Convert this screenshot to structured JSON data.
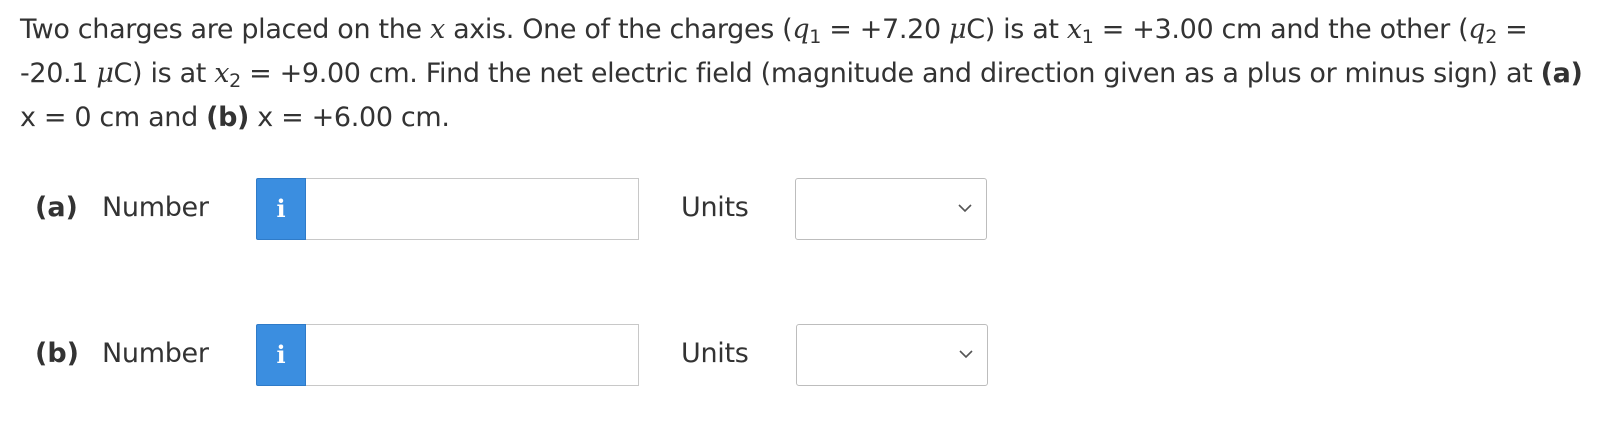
{
  "question": {
    "t1": "Two charges are placed on the ",
    "x_var": "x",
    "t2": " axis. One of the charges (",
    "q": "q",
    "sub1": "1",
    "t3": " = +7.20 ",
    "mu": "μ",
    "t4": "C) is at ",
    "x1": "x",
    "sub_x1": "1",
    "t5": " = +3.00 cm and the other (",
    "q2": "q",
    "sub2": "2",
    "t6": " = -20.1 ",
    "mu2": "μ",
    "t7": "C) is at ",
    "x2": "x",
    "sub_x2": "2",
    "t8": " = +9.00 cm. Find the net electric field (magnitude and direction given as a plus or minus sign) at ",
    "part_a": "(a)",
    "t9": " x = 0 cm and ",
    "part_b": "(b)",
    "t10": " x = +6.00 cm."
  },
  "parts": [
    {
      "label": "(a)",
      "number_label": "Number",
      "info_icon": "i",
      "number_value": "",
      "units_label": "Units",
      "units_selected": ""
    },
    {
      "label": "(b)",
      "number_label": "Number",
      "info_icon": "i",
      "number_value": "",
      "units_label": "Units",
      "units_selected": ""
    }
  ],
  "colors": {
    "info_button": "#3b8ee0",
    "text": "#333333",
    "input_border": "#c8c8c8"
  },
  "icons": {
    "info": "info-icon",
    "dropdown": "chevron-down-icon"
  }
}
